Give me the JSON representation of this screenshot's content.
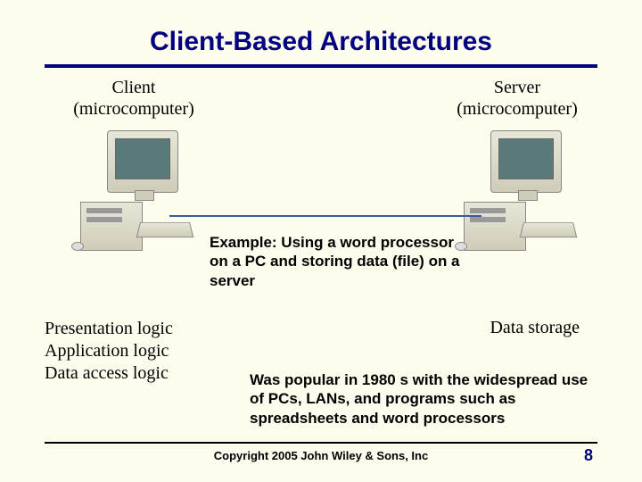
{
  "title": "Client-Based Architectures",
  "client": {
    "heading": "Client",
    "sub": "(microcomputer)",
    "logic": [
      "Presentation logic",
      "Application logic",
      "Data access logic"
    ]
  },
  "server": {
    "heading": "Server",
    "sub": "(microcomputer)",
    "role": "Data storage"
  },
  "example": "Example: Using a word processor on a PC and storing data (file) on a server",
  "popularity": "Was popular in 1980 s with the widespread use of PCs, LANs, and programs such as spreadsheets and word processors",
  "footer": {
    "copyright": "Copyright 2005 John Wiley & Sons, Inc",
    "page": "8"
  }
}
